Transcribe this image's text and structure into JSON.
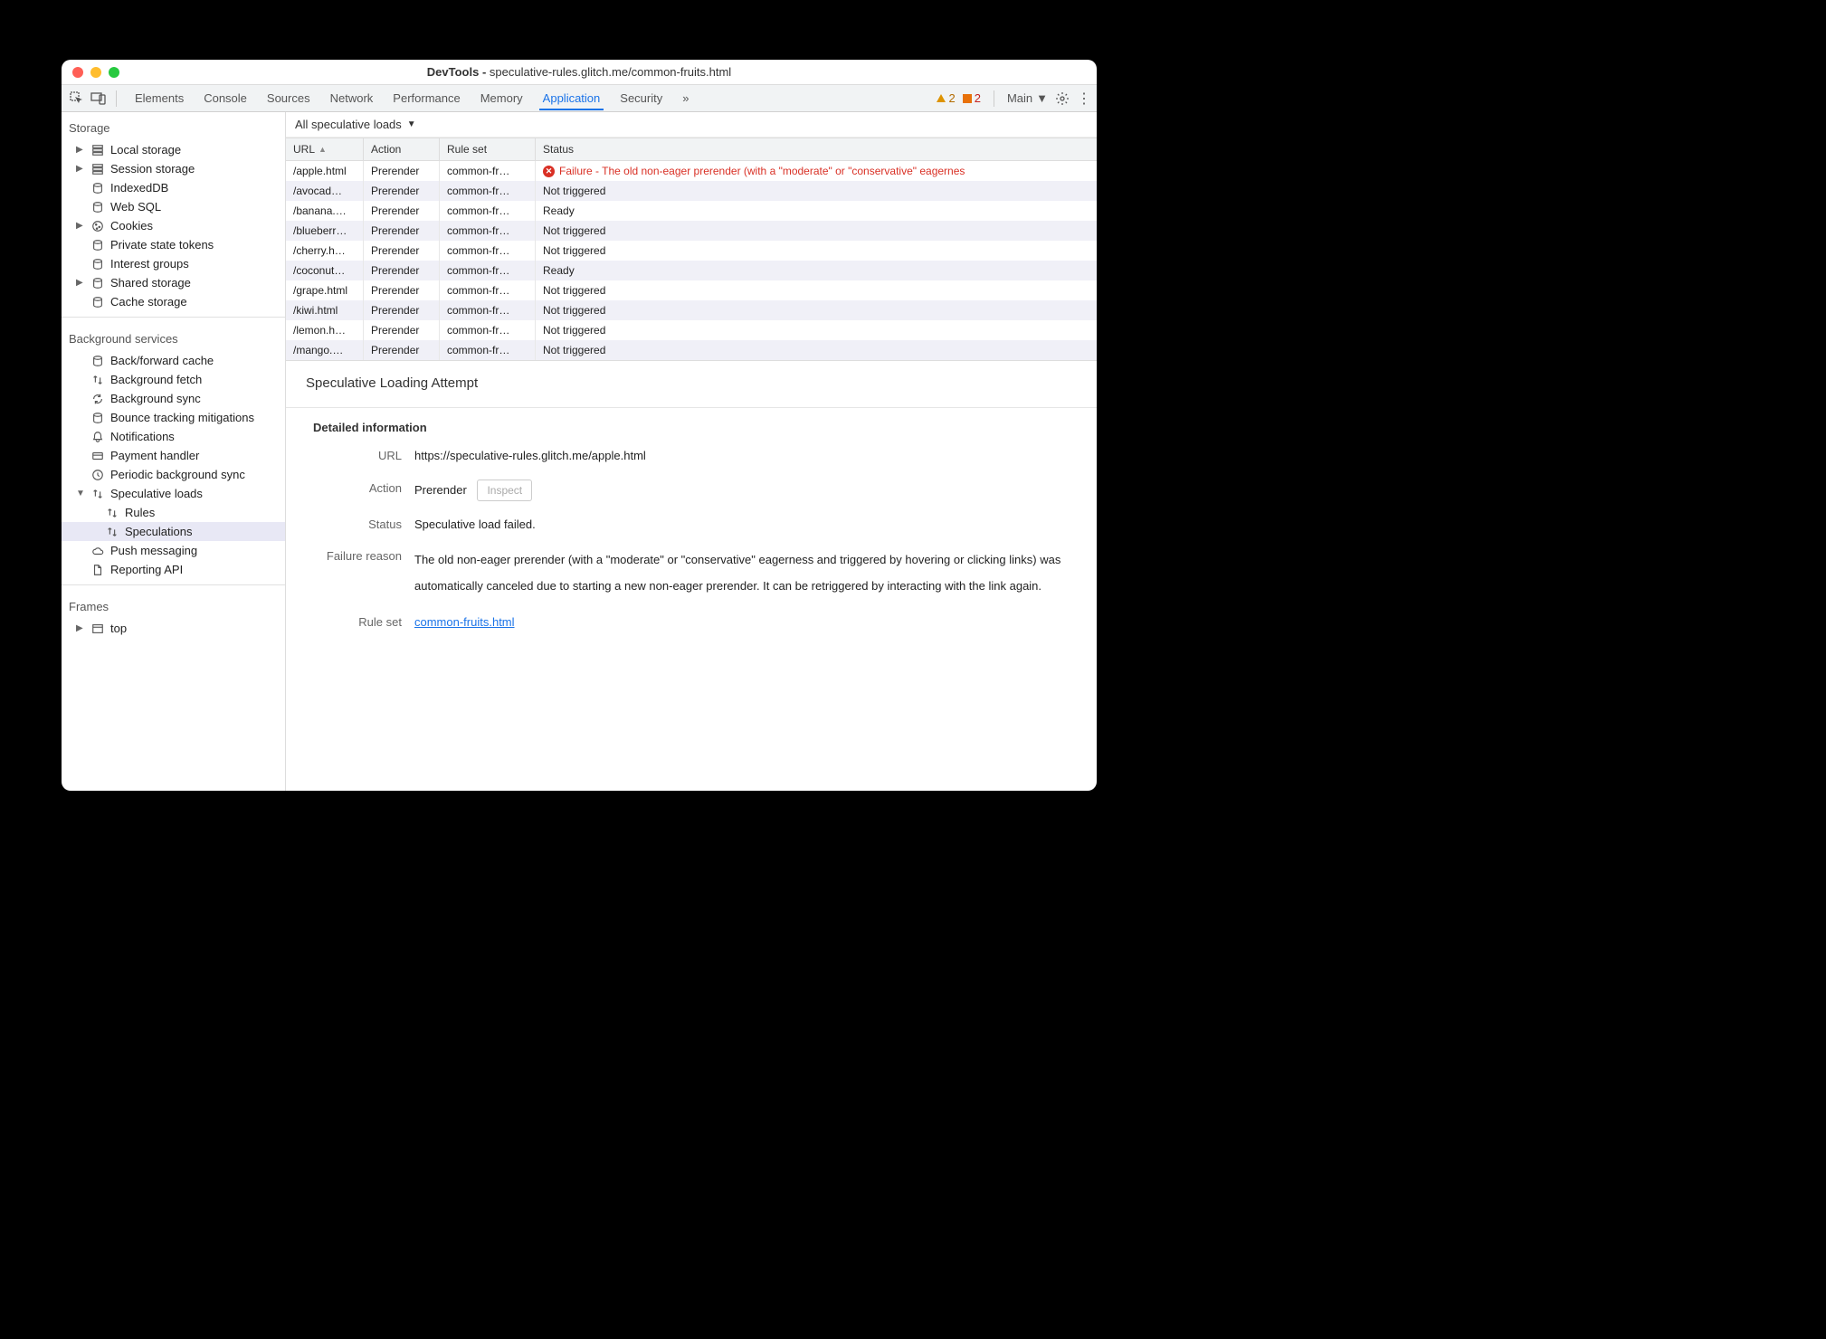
{
  "window": {
    "title_prefix": "DevTools - ",
    "title_url": "speculative-rules.glitch.me/common-fruits.html"
  },
  "toolbar": {
    "tabs": [
      "Elements",
      "Console",
      "Sources",
      "Network",
      "Performance",
      "Memory",
      "Application",
      "Security"
    ],
    "active_tab": "Application",
    "warning_count": "2",
    "issue_count": "2",
    "target": "Main"
  },
  "sidebar": {
    "storage": {
      "title": "Storage",
      "items": [
        {
          "label": "Local storage",
          "expandable": true,
          "icon": "db"
        },
        {
          "label": "Session storage",
          "expandable": true,
          "icon": "db"
        },
        {
          "label": "IndexedDB",
          "icon": "cyl"
        },
        {
          "label": "Web SQL",
          "icon": "cyl"
        },
        {
          "label": "Cookies",
          "expandable": true,
          "icon": "cookie"
        },
        {
          "label": "Private state tokens",
          "icon": "cyl"
        },
        {
          "label": "Interest groups",
          "icon": "cyl"
        },
        {
          "label": "Shared storage",
          "expandable": true,
          "icon": "cyl"
        },
        {
          "label": "Cache storage",
          "icon": "cyl"
        }
      ]
    },
    "bgservices": {
      "title": "Background services",
      "items": [
        {
          "label": "Back/forward cache",
          "icon": "cyl"
        },
        {
          "label": "Background fetch",
          "icon": "updown"
        },
        {
          "label": "Background sync",
          "icon": "sync"
        },
        {
          "label": "Bounce tracking mitigations",
          "icon": "cyl"
        },
        {
          "label": "Notifications",
          "icon": "bell"
        },
        {
          "label": "Payment handler",
          "icon": "card"
        },
        {
          "label": "Periodic background sync",
          "icon": "clock"
        },
        {
          "label": "Speculative loads",
          "icon": "updown",
          "expandable": true,
          "expanded": true
        },
        {
          "label": "Rules",
          "icon": "updown",
          "sub": true
        },
        {
          "label": "Speculations",
          "icon": "updown",
          "sub": true,
          "selected": true
        },
        {
          "label": "Push messaging",
          "icon": "cloud"
        },
        {
          "label": "Reporting API",
          "icon": "doc"
        }
      ]
    },
    "frames": {
      "title": "Frames",
      "items": [
        {
          "label": "top",
          "expandable": true,
          "icon": "frame"
        }
      ]
    }
  },
  "filter": "All speculative loads",
  "table": {
    "headers": {
      "url": "URL",
      "action": "Action",
      "ruleset": "Rule set",
      "status": "Status"
    },
    "rows": [
      {
        "url": "/apple.html",
        "action": "Prerender",
        "ruleset": "common-fr…",
        "status": "Failure - The old non-eager prerender (with a \"moderate\" or \"conservative\" eagernes",
        "error": true
      },
      {
        "url": "/avocad…",
        "action": "Prerender",
        "ruleset": "common-fr…",
        "status": "Not triggered"
      },
      {
        "url": "/banana.…",
        "action": "Prerender",
        "ruleset": "common-fr…",
        "status": "Ready"
      },
      {
        "url": "/blueberr…",
        "action": "Prerender",
        "ruleset": "common-fr…",
        "status": "Not triggered"
      },
      {
        "url": "/cherry.h…",
        "action": "Prerender",
        "ruleset": "common-fr…",
        "status": "Not triggered"
      },
      {
        "url": "/coconut…",
        "action": "Prerender",
        "ruleset": "common-fr…",
        "status": "Ready"
      },
      {
        "url": "/grape.html",
        "action": "Prerender",
        "ruleset": "common-fr…",
        "status": "Not triggered"
      },
      {
        "url": "/kiwi.html",
        "action": "Prerender",
        "ruleset": "common-fr…",
        "status": "Not triggered"
      },
      {
        "url": "/lemon.h…",
        "action": "Prerender",
        "ruleset": "common-fr…",
        "status": "Not triggered"
      },
      {
        "url": "/mango.…",
        "action": "Prerender",
        "ruleset": "common-fr…",
        "status": "Not triggered"
      }
    ]
  },
  "details": {
    "heading": "Speculative Loading Attempt",
    "section": "Detailed information",
    "labels": {
      "url": "URL",
      "action": "Action",
      "status": "Status",
      "failure": "Failure reason",
      "ruleset": "Rule set"
    },
    "url": "https://speculative-rules.glitch.me/apple.html",
    "action": "Prerender",
    "inspect": "Inspect",
    "status": "Speculative load failed.",
    "failure_reason": "The old non-eager prerender (with a \"moderate\" or \"conservative\" eagerness and triggered by hovering or clicking links) was automatically canceled due to starting a new non-eager prerender. It can be retriggered by interacting with the link again.",
    "ruleset_link": "common-fruits.html"
  }
}
